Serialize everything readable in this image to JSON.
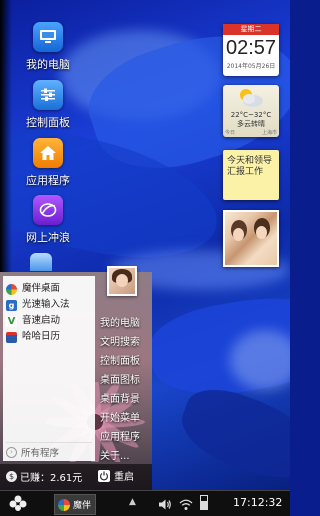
{
  "desktop": {
    "icons": [
      {
        "label": "我的电脑",
        "icon": "computer-icon"
      },
      {
        "label": "控制面板",
        "icon": "sliders-icon"
      },
      {
        "label": "应用程序",
        "icon": "home-icon"
      },
      {
        "label": "网上冲浪",
        "icon": "browser-icon"
      }
    ]
  },
  "widgets": {
    "calendar": {
      "weekday": "星期二",
      "time": "02:57",
      "date": "2014年05月26日"
    },
    "weather": {
      "temp": "22°C~32°C",
      "condition": "多云转晴",
      "day": "今日",
      "city": "上海市"
    },
    "note": {
      "text": "今天和领导汇报工作"
    }
  },
  "start_menu": {
    "left_items": [
      {
        "label": "魔伴桌面",
        "icon": "pinwheel-icon",
        "color": "#3aa64a"
      },
      {
        "label": "光速输入法",
        "icon": "keyboard-g-icon",
        "color": "#2b6cc4"
      },
      {
        "label": "音速启动",
        "icon": "v-launch-icon",
        "color": "#2e9b3a"
      },
      {
        "label": "哈哈日历",
        "icon": "calendar-icon",
        "color": "#2a5aa8"
      }
    ],
    "all_programs": "所有程序",
    "right_items": [
      "我的电脑",
      "文明搜索",
      "控制面板",
      "桌面图标",
      "桌面背景",
      "开始菜单",
      "应用程序",
      "关于..."
    ],
    "earned": "已赚：2.61元",
    "restart": "重启"
  },
  "taskbar": {
    "app_label": "魔伴",
    "clock": "17:12:32"
  }
}
